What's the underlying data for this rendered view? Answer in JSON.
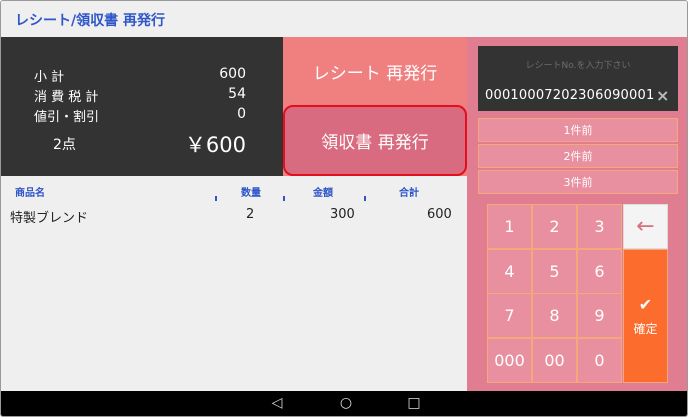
{
  "header": {
    "title": "レシート/領収書 再発行"
  },
  "summary": {
    "subtotal_label": "小 計",
    "subtotal_value": "600",
    "tax_label": "消 費 税 計",
    "tax_value": "54",
    "discount_label": "値引・割引",
    "discount_value": "0",
    "count_label": "2点",
    "total_value": "￥600"
  },
  "actions": {
    "receipt_reissue": "レシート 再発行",
    "ryoshusho_reissue": "領収書 再発行"
  },
  "table": {
    "headers": {
      "name": "商品名",
      "qty": "数量",
      "amount": "金額",
      "total": "合計"
    },
    "rows": [
      {
        "name": "特製ブレンド",
        "qty": "2",
        "amount": "300",
        "total": "600"
      }
    ]
  },
  "receipt_input": {
    "placeholder": "レシートNo.を入力下さい",
    "value": "00010007202306090001",
    "clear_icon": "×"
  },
  "prev_buttons": [
    "1件前",
    "2件前",
    "3件前"
  ],
  "keypad": {
    "keys": [
      "1",
      "2",
      "3",
      "4",
      "5",
      "6",
      "7",
      "8",
      "9",
      "000",
      "00",
      "0"
    ],
    "backspace": "←",
    "confirm_check": "✔",
    "confirm_label": "確定"
  },
  "navbar": {
    "back": "◁",
    "home": "○",
    "recents": "□"
  },
  "colors": {
    "title_blue": "#2f56c8",
    "dark_panel": "#333333",
    "pink_button": "#f08080",
    "selected_button": "#d86b7f",
    "highlight_red": "#e40e1c",
    "confirm_orange": "#fb6c2d"
  }
}
